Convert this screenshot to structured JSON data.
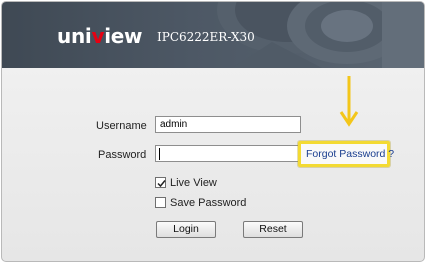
{
  "header": {
    "logo_prefix": "uni",
    "logo_accent": "v",
    "logo_suffix": "iew",
    "model": "IPC6222ER-X30"
  },
  "form": {
    "username_label": "Username",
    "username_value": "admin",
    "password_label": "Password",
    "password_value": "",
    "forgot_link": "Forgot Password ?",
    "live_view_label": "Live View",
    "live_view_checked": true,
    "save_password_label": "Save Password",
    "save_password_checked": false,
    "login_button": "Login",
    "reset_button": "Reset"
  },
  "colors": {
    "header_bg": "#48525e",
    "logo_accent": "#e60012",
    "highlight": "#f3da33",
    "link": "#1a3e8f"
  }
}
